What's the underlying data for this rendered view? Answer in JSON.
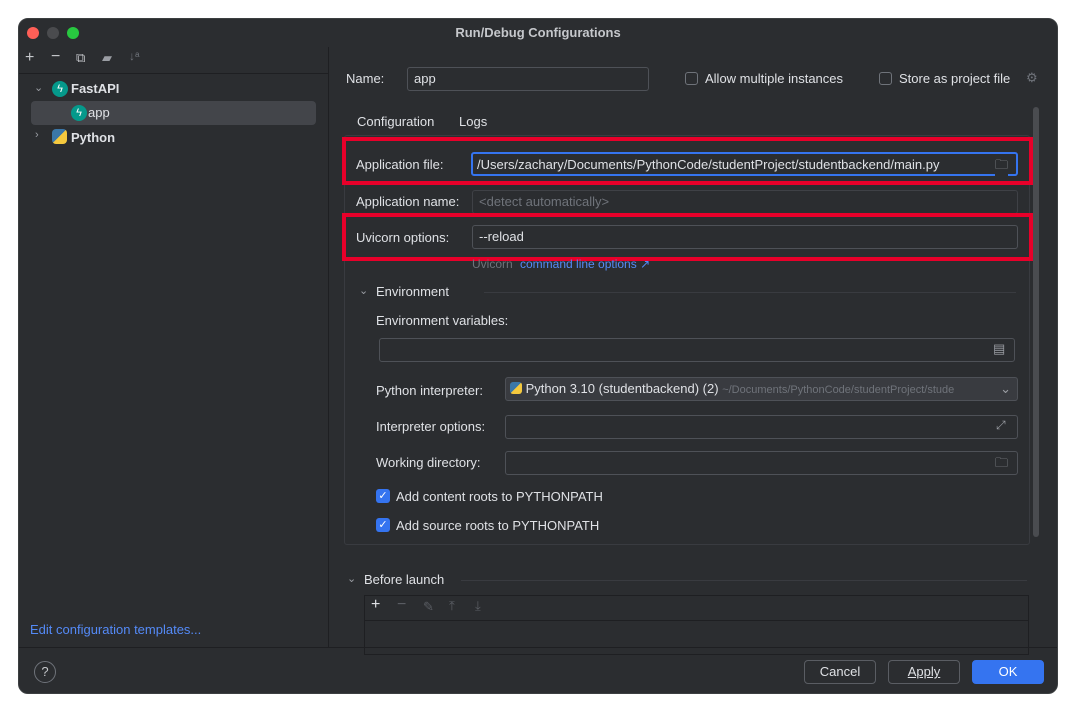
{
  "window": {
    "title": "Run/Debug Configurations"
  },
  "sidebar": {
    "toolbar": [
      "add-icon",
      "remove-icon",
      "copy-icon",
      "new-folder-icon",
      "sort-icon"
    ],
    "tree": [
      {
        "label": "FastAPI",
        "expanded": true,
        "children": [
          {
            "label": "app",
            "selected": true
          }
        ]
      },
      {
        "label": "Python",
        "expanded": false
      }
    ],
    "edit_templates": "Edit configuration templates..."
  },
  "header": {
    "name_label": "Name:",
    "name_value": "app",
    "allow_multiple": "Allow multiple instances",
    "store_project": "Store as project file"
  },
  "tabs": [
    "Configuration",
    "Logs"
  ],
  "form": {
    "app_file_label": "Application file:",
    "app_file_value": "/Users/zachary/Documents/PythonCode/studentProject/studentbackend/main.py",
    "app_name_label": "Application name:",
    "app_name_placeholder": "<detect automatically>",
    "uvicorn_label": "Uvicorn options:",
    "uvicorn_value": "--reload",
    "uvicorn_hint": "Uvicorn",
    "uvicorn_link": "command line options ↗"
  },
  "environment": {
    "section": "Environment",
    "env_vars_label": "Environment variables:",
    "env_vars_value": "",
    "interp_label": "Python interpreter:",
    "interp_value": "Python 3.10 (studentbackend) (2)",
    "interp_path": "~/Documents/PythonCode/studentProject/stude",
    "interp_opts_label": "Interpreter options:",
    "workdir_label": "Working directory:",
    "content_roots": "Add content roots to PYTHONPATH",
    "source_roots": "Add source roots to PYTHONPATH",
    "content_roots_checked": true,
    "source_roots_checked": true
  },
  "before_launch": {
    "section": "Before launch"
  },
  "footer": {
    "help": "?",
    "cancel": "Cancel",
    "apply": "Apply",
    "ok": "OK"
  },
  "colors": {
    "accent": "#3574f0",
    "highlight": "#e8002a",
    "link": "#548af7"
  }
}
